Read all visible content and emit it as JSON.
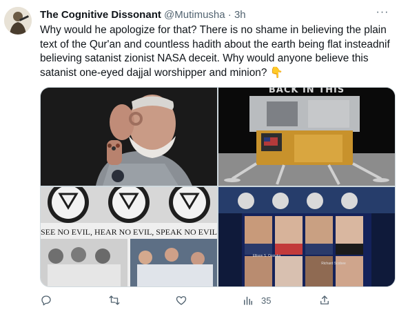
{
  "tweet": {
    "display_name": "The Cognitive Dissonant",
    "handle": "@Mutimusha",
    "separator": "·",
    "time": "3h",
    "more": "···",
    "text": "Why would he apologize for that? There is no shame in believing the plain text of the Qur'an and countless hadith about the earth being flat insteadnif believing satanist zionist NASA deceit. Why would anyone believe this satanist one-eyed dajjal worshipper and minion? 👇"
  },
  "media": {
    "image2_caption": "BACK IN THIS",
    "image3_caption": "SEE NO EVIL, HEAR NO EVIL, SPEAK NO EVIL",
    "image4_left_caption": "Ellison S. Onizuka",
    "image4_right_caption": "Richard Scobee"
  },
  "actions": {
    "reply_icon": "reply-icon",
    "retweet_icon": "retweet-icon",
    "like_icon": "like-icon",
    "views_icon": "views-icon",
    "views_count": "35",
    "share_icon": "share-icon"
  },
  "colors": {
    "text": "#0f1419",
    "secondary": "#536471",
    "border": "#cfd9de"
  }
}
